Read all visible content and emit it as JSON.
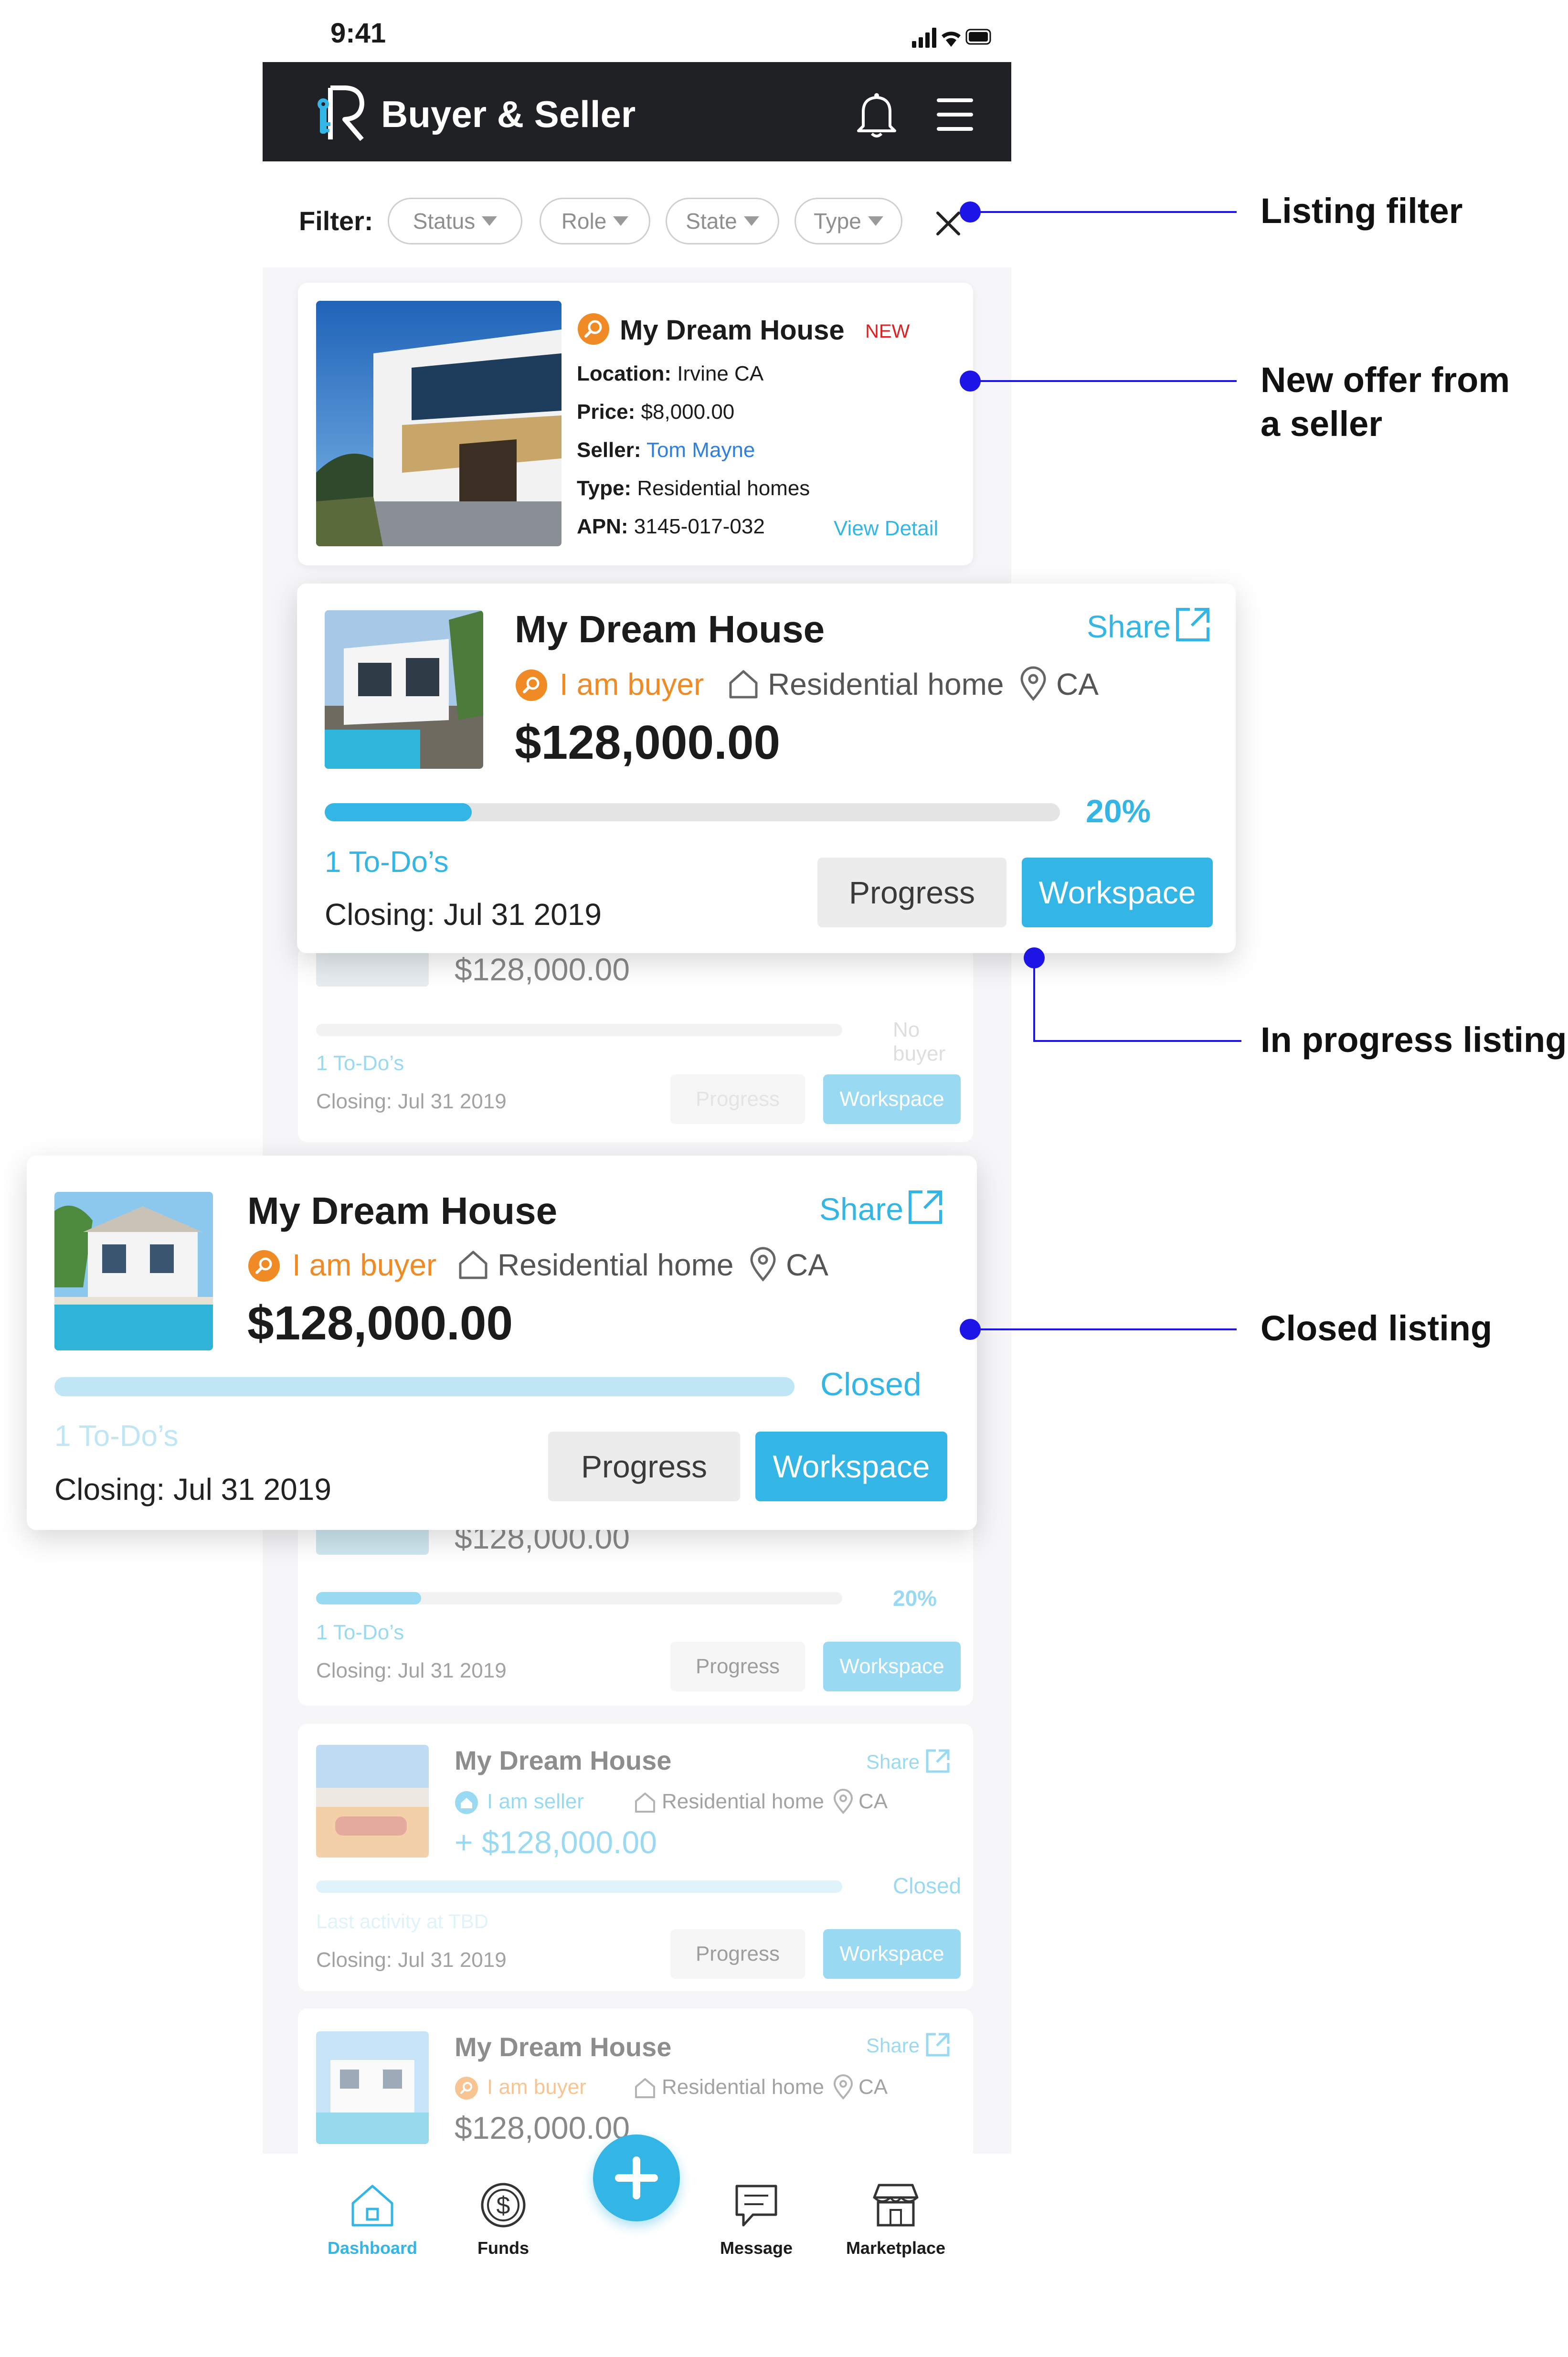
{
  "status_bar": {
    "time": "9:41"
  },
  "app": {
    "title": "Buyer & Seller"
  },
  "filter": {
    "label": "Filter:",
    "chips": [
      "Status",
      "Role",
      "State",
      "Type"
    ]
  },
  "offer_card": {
    "title": "My Dream House",
    "badge": "NEW",
    "location_label": "Location:",
    "location": "Irvine CA",
    "price_label": "Price:",
    "price": "$8,000.00",
    "seller_label": "Seller:",
    "seller": "Tom Mayne",
    "type_label": "Type:",
    "type": "Residential homes",
    "apn_label": "APN:",
    "apn": "3145-017-032",
    "view_detail": "View Detail"
  },
  "in_progress_card": {
    "title": "My Dream House",
    "share": "Share",
    "role": "I am buyer",
    "property_type": "Residential home",
    "state": "CA",
    "price": "$128,000.00",
    "progress_percent": 20,
    "progress_label": "20%",
    "todos": "1 To-Do’s",
    "closing": "Closing: Jul 31 2019",
    "progress_btn": "Progress",
    "workspace_btn": "Workspace"
  },
  "background_card_1": {
    "price": "$128,000.00",
    "status": "No buyer",
    "todos": "1 To-Do’s",
    "closing": "Closing: Jul 31 2019",
    "progress_btn": "Progress",
    "workspace_btn": "Workspace"
  },
  "closed_card": {
    "title": "My Dream House",
    "share": "Share",
    "role": "I am buyer",
    "property_type": "Residential home",
    "state": "CA",
    "price": "$128,000.00",
    "status": "Closed",
    "todos": "1 To-Do’s",
    "closing": "Closing: Jul 31 2019",
    "progress_btn": "Progress",
    "workspace_btn": "Workspace"
  },
  "background_card_2": {
    "price": "$128,000.00",
    "progress_percent": 20,
    "progress_label": "20%",
    "todos": "1 To-Do’s",
    "closing": "Closing: Jul 31 2019",
    "progress_btn": "Progress",
    "workspace_btn": "Workspace"
  },
  "background_card_3": {
    "title": "My Dream House",
    "share": "Share",
    "role": "I am seller",
    "property_type": "Residential home",
    "state": "CA",
    "price": "+ $128,000.00",
    "status": "Closed",
    "activity": "Last activity at TBD",
    "closing": "Closing: Jul 31 2019",
    "progress_btn": "Progress",
    "workspace_btn": "Workspace"
  },
  "background_card_4": {
    "title": "My Dream House",
    "share": "Share",
    "role": "I am buyer",
    "property_type": "Residential home",
    "state": "CA",
    "price": "$128,000.00"
  },
  "tab_bar": {
    "tabs": [
      "Dashboard",
      "Funds",
      "Message",
      "Marketplace"
    ],
    "active": "Dashboard"
  },
  "callouts": {
    "listing_filter": "Listing filter",
    "new_offer_1": "New offer from",
    "new_offer_2": "a seller",
    "in_progress": "In progress listing",
    "closed": "Closed listing"
  },
  "colors": {
    "accent": "#33b5e5",
    "buyer_orange": "#f08a24",
    "new_red": "#e02020",
    "link_blue": "#2f7fe0",
    "callout": "#1c15e6",
    "app_bar": "#202124"
  }
}
